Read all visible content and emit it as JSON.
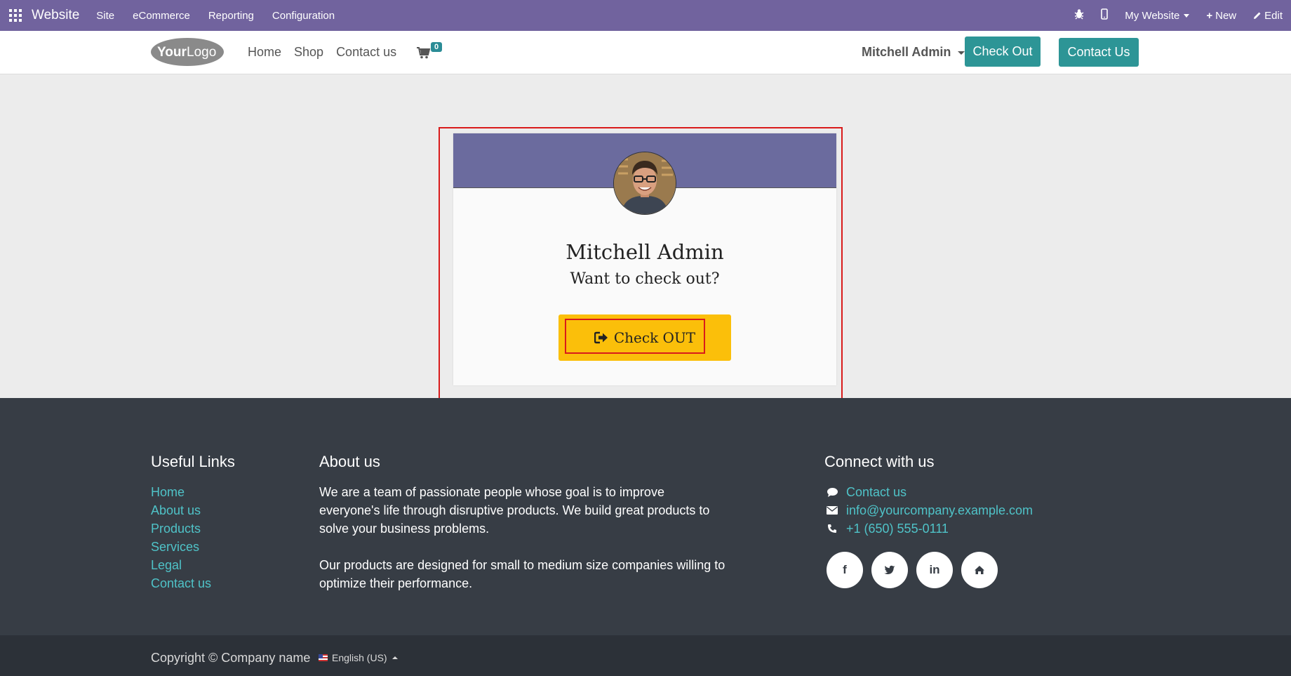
{
  "topbar": {
    "app_name": "Website",
    "menu": [
      "Site",
      "eCommerce",
      "Reporting",
      "Configuration"
    ],
    "website_selector": "My Website",
    "new_label": "New",
    "edit_label": "Edit"
  },
  "header": {
    "logo_text_bold": "Your",
    "logo_text_light": "Logo",
    "nav": [
      "Home",
      "Shop",
      "Contact us"
    ],
    "cart_count": "0",
    "user_name": "Mitchell Admin",
    "checkout_button": "Check Out",
    "contact_button": "Contact Us"
  },
  "card": {
    "name": "Mitchell Admin",
    "question": "Want to check out?",
    "button_label": "Check OUT"
  },
  "footer": {
    "useful_links_title": "Useful Links",
    "useful_links": [
      "Home",
      "About us",
      "Products",
      "Services",
      "Legal",
      "Contact us"
    ],
    "about_title": "About us",
    "about_p1": "We are a team of passionate people whose goal is to improve everyone's life through disruptive products. We build great products to solve your business problems.",
    "about_p2": "Our products are designed for small to medium size companies willing to optimize their performance.",
    "connect_title": "Connect with us",
    "contact_link": "Contact us",
    "email": "info@yourcompany.example.com",
    "phone": "+1 (650) 555-0111",
    "socials": [
      "f",
      "in"
    ]
  },
  "bottom": {
    "copyright": "Copyright © Company name",
    "language": "English (US)"
  },
  "colors": {
    "topbar": "#71639e",
    "teal": "#2d9596",
    "checkout_yellow": "#fbbf0a",
    "footer": "#373d45",
    "highlight": "#d91b1b"
  }
}
